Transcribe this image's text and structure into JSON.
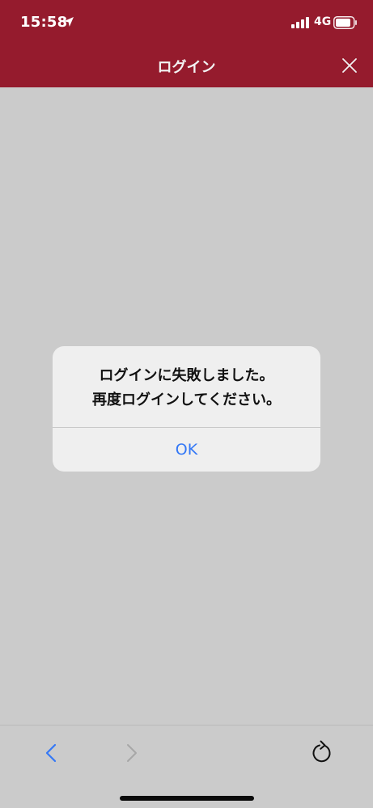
{
  "status_bar": {
    "time": "15:58",
    "network": "4G"
  },
  "nav": {
    "title": "ログイン"
  },
  "alert": {
    "message_lines": [
      "ログインに失敗しました。",
      "再度ログインしてください。"
    ],
    "ok_label": "OK"
  },
  "colors": {
    "header_bg": "#951b2d",
    "page_bg": "#cbcbcb",
    "alert_bg": "#efefef",
    "ios_blue": "#3478f6"
  },
  "icons": {
    "status": [
      "location-arrow-icon",
      "signal-bars-icon",
      "battery-icon"
    ],
    "nav": [
      "close-icon"
    ],
    "toolbar": [
      "back-chevron-icon",
      "forward-chevron-icon",
      "reload-icon"
    ]
  }
}
